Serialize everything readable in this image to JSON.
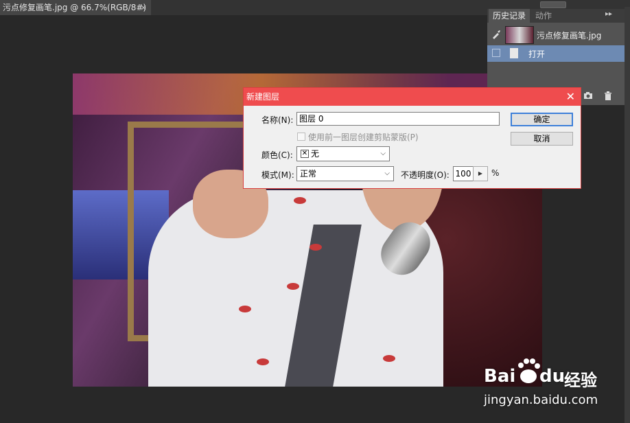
{
  "document_tab": {
    "title": "污点修复画笔.jpg @ 66.7%(RGB/8#)",
    "close": "×"
  },
  "history_panel": {
    "tabs": [
      "历史记录",
      "动作"
    ],
    "expand_icon": "▸▸",
    "menu_icon": "▾≡",
    "snapshot_label": "污点修复画笔.jpg",
    "entries": [
      {
        "label": "打开"
      }
    ],
    "footer_icons": [
      "camera-icon",
      "trash-icon"
    ]
  },
  "dialog": {
    "title": "新建图层",
    "close": "✕",
    "name_label": "名称(N):",
    "name_value": "图层 0",
    "clip_label": "使用前一图层创建剪贴蒙版(P)",
    "color_label": "颜色(C):",
    "color_value": "无",
    "mode_label": "模式(M):",
    "mode_value": "正常",
    "opacity_label": "不透明度(O):",
    "opacity_value": "100",
    "opacity_unit": "%",
    "ok_label": "确定",
    "cancel_label": "取消"
  },
  "watermark": {
    "brand": "Bai",
    "brand2": "du",
    "sub": "经验",
    "url": "jingyan.baidu.com"
  },
  "colors": {
    "dialog_title": "#ef4c4e",
    "history_selected": "#6d8ab3",
    "workspace": "#282828"
  }
}
